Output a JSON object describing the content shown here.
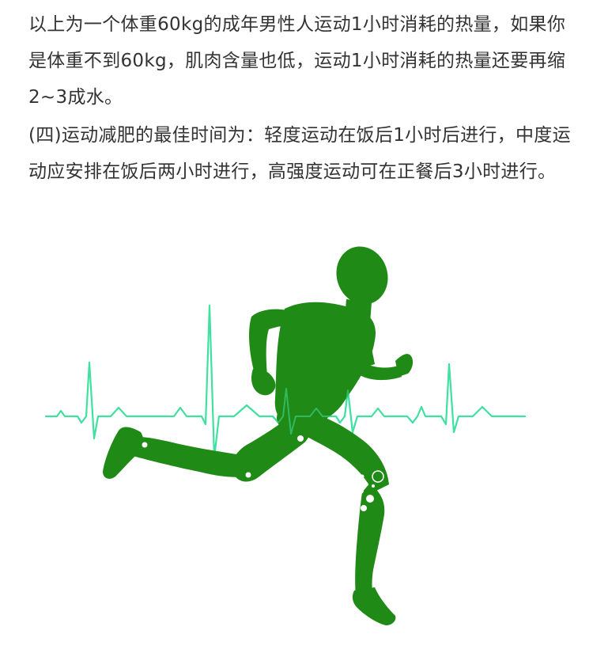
{
  "article": {
    "paragraph_1": "以上为一个体重60kg的成年男性人运动1小时消耗的热量，如果你是体重不到60kg，肌肉含量也低，运动1小时消耗的热量还要再缩2~3成水。",
    "paragraph_2": "(四)运动减肥的最佳时间为：轻度运动在饭后1小时后进行，中度运动应安排在饭后两小时进行，高强度运动可在正餐后3小时进行。"
  },
  "illustration": {
    "runner_color": "#1f8a15",
    "heartbeat_color": "#3fe0a0",
    "icons": [
      "running-man-icon",
      "heartbeat-line-icon"
    ]
  }
}
